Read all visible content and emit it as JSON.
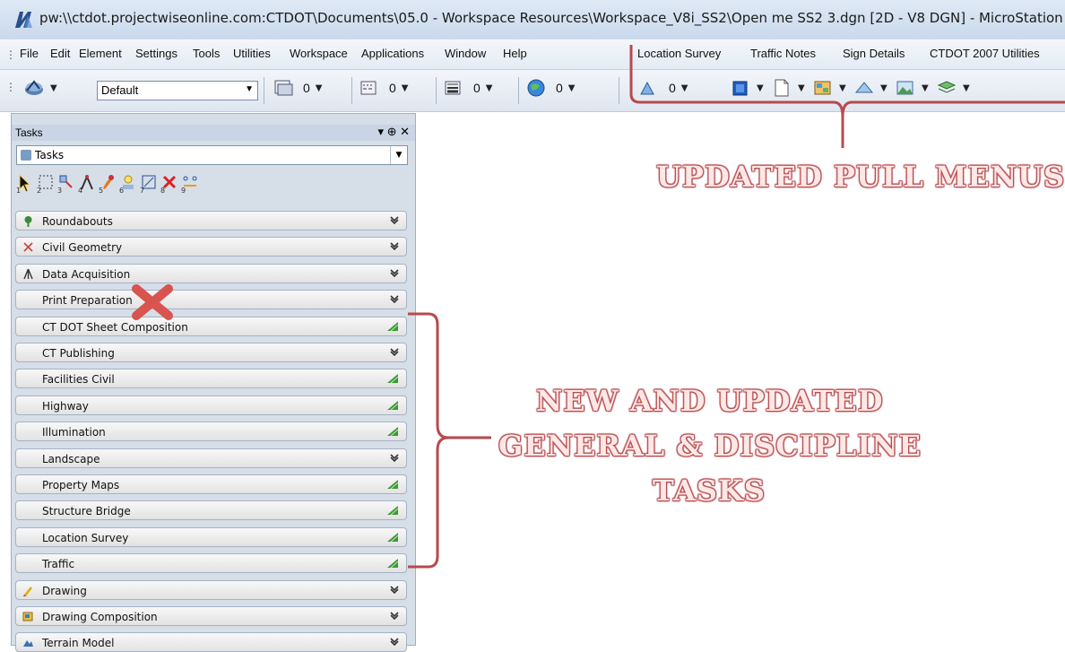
{
  "window": {
    "title": "pw:\\\\ctdot.projectwiseonline.com:CTDOT\\Documents\\05.0 - Workspace Resources\\Workspace_V8i_SS2\\Open me SS2 3.dgn [2D - V8 DGN] - MicroStation"
  },
  "menu": {
    "items": [
      {
        "label": "File"
      },
      {
        "label": "Edit"
      },
      {
        "label": "Element"
      },
      {
        "label": "Settings"
      },
      {
        "label": "Tools"
      },
      {
        "label": "Utilities"
      },
      {
        "label": "Workspace"
      },
      {
        "label": "Applications"
      },
      {
        "label": "Window"
      },
      {
        "label": "Help"
      },
      {
        "label": "Location Survey"
      },
      {
        "label": "Traffic Notes"
      },
      {
        "label": "Sign Details"
      },
      {
        "label": "CTDOT 2007 Utilities"
      }
    ]
  },
  "toolbar": {
    "level_value": "Default",
    "color_value": "0",
    "style_value": "0",
    "weight_value": "0",
    "transparency_value": "0",
    "extra_value": "0"
  },
  "tasks": {
    "header": "Tasks",
    "controls": "▾ ⊕ ✕",
    "selector": "Tasks",
    "tool_numbers": [
      "1",
      "2",
      "3",
      "4",
      "5",
      "6",
      "7",
      "8",
      "9"
    ],
    "rows": [
      {
        "label": "Roundabouts",
        "icon": "roundabout-icon",
        "state": "collapsed"
      },
      {
        "label": "Civil Geometry",
        "icon": "geometry-icon",
        "state": "collapsed"
      },
      {
        "label": "Data Acquisition",
        "icon": "survey-icon",
        "state": "collapsed"
      },
      {
        "label": "Print Preparation",
        "icon": "",
        "state": "collapsed"
      },
      {
        "label": "CT DOT Sheet Composition",
        "icon": "",
        "state": "new"
      },
      {
        "label": "CT Publishing",
        "icon": "",
        "state": "collapsed"
      },
      {
        "label": "Facilities Civil",
        "icon": "",
        "state": "new"
      },
      {
        "label": "Highway",
        "icon": "",
        "state": "new"
      },
      {
        "label": "Illumination",
        "icon": "",
        "state": "new"
      },
      {
        "label": "Landscape",
        "icon": "",
        "state": "collapsed"
      },
      {
        "label": "Property Maps",
        "icon": "",
        "state": "new"
      },
      {
        "label": "Structure Bridge",
        "icon": "",
        "state": "new"
      },
      {
        "label": "Location Survey",
        "icon": "",
        "state": "new"
      },
      {
        "label": "Traffic",
        "icon": "",
        "state": "new"
      },
      {
        "label": "Drawing",
        "icon": "drawing-icon",
        "state": "collapsed"
      },
      {
        "label": "Drawing Composition",
        "icon": "composition-icon",
        "state": "collapsed"
      },
      {
        "label": "Terrain Model",
        "icon": "terrain-icon",
        "state": "collapsed"
      }
    ]
  },
  "annotations": {
    "pull_menus": "UPDATED PULL MENUS",
    "tasks_line1": "NEW AND UPDATED",
    "tasks_line2": "GENERAL & DISCIPLINE",
    "tasks_line3": "TASKS"
  },
  "colors": {
    "annotation": "#b74a4e",
    "remove_mark": "#d9534f"
  }
}
